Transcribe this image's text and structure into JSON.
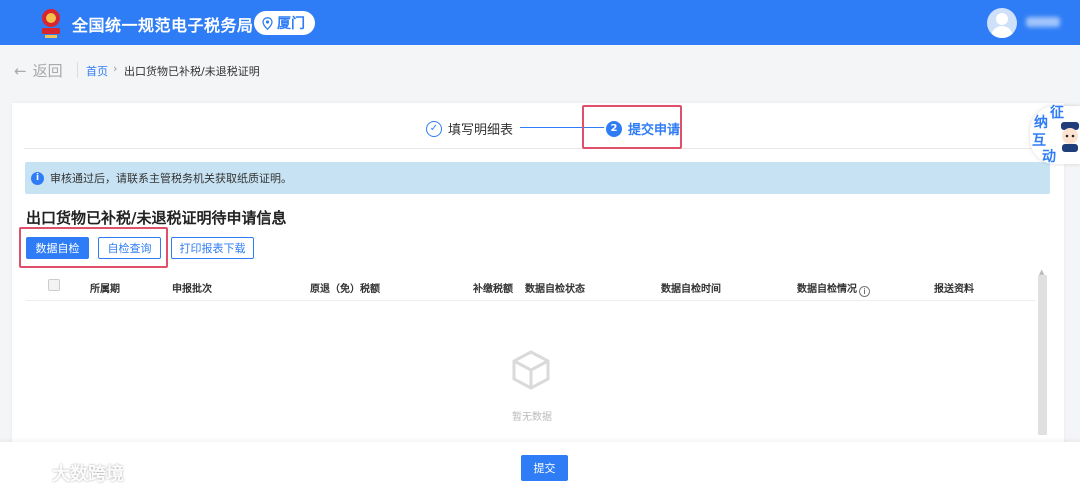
{
  "header": {
    "title": "全国统一规范电子税务局",
    "city": "厦门",
    "colors": {
      "brand": "#2f7df6",
      "highlight": "#e0506a"
    }
  },
  "breadcrumb": {
    "back": "返回",
    "home": "首页",
    "separator": "›",
    "current": "出口货物已补税/未退税证明"
  },
  "steps": {
    "step1_label": "填写明细表",
    "step2_number": "2",
    "step2_label": "提交申请"
  },
  "alert": {
    "icon": "i",
    "text": "审核通过后，请联系主管税务机关获取纸质证明。"
  },
  "section": {
    "title": "出口货物已补税/未退税证明待申请信息"
  },
  "toolbar": {
    "self_check": "数据自检",
    "self_check_query": "自检查询",
    "print_download": "打印报表下载"
  },
  "table": {
    "columns": [
      "所属期",
      "申报批次",
      "原退（免）税额",
      "补缴税额",
      "数据自检状态",
      "数据自检时间",
      "数据自检情况",
      "报送资料"
    ],
    "empty_text": "暂无数据"
  },
  "footer": {
    "submit": "提交"
  },
  "mascot": {
    "chars": [
      "征",
      "纳",
      "互",
      "动"
    ]
  },
  "watermark": {
    "text": "大数跨境"
  }
}
